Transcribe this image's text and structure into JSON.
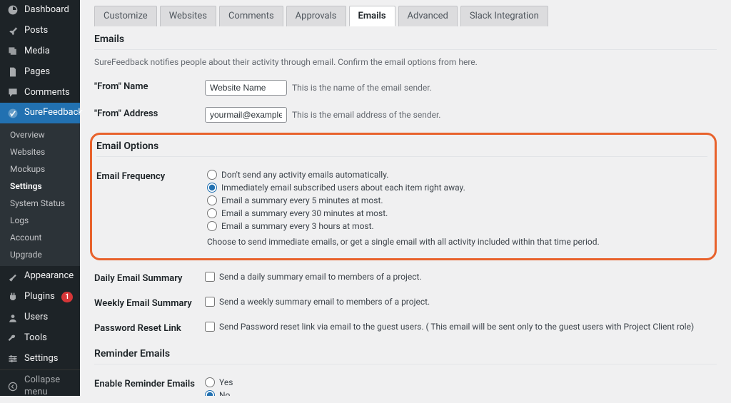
{
  "sidebar": {
    "dashboard": "Dashboard",
    "posts": "Posts",
    "media": "Media",
    "pages": "Pages",
    "comments": "Comments",
    "surefeedback": "SureFeedback",
    "sf_sub": [
      "Overview",
      "Websites",
      "Mockups",
      "Settings",
      "System Status",
      "Logs",
      "Account",
      "Upgrade"
    ],
    "appearance": "Appearance",
    "plugins": "Plugins",
    "plugins_badge": "1",
    "users": "Users",
    "tools": "Tools",
    "settings": "Settings",
    "collapse": "Collapse menu"
  },
  "tabs": [
    "Customize",
    "Websites",
    "Comments",
    "Approvals",
    "Emails",
    "Advanced",
    "Slack Integration"
  ],
  "emails": {
    "heading": "Emails",
    "desc": "SureFeedback notifies people about their activity through email. Confirm the email options from here.",
    "from_name_label": "\"From\" Name",
    "from_name_value": "Website Name",
    "from_name_hint": "This is the name of the email sender.",
    "from_addr_label": "\"From\" Address",
    "from_addr_value": "yourmail@example.com",
    "from_addr_hint": "This is the email address of the sender."
  },
  "options": {
    "heading": "Email Options",
    "freq_label": "Email Frequency",
    "freq_opts": [
      "Don't send any activity emails automatically.",
      "Immediately email subscribed users about each item right away.",
      "Email a summary every 5 minutes at most.",
      "Email a summary every 30 minutes at most.",
      "Email a summary every 3 hours at most."
    ],
    "freq_note": "Choose to send immediate emails, or get a single email with all activity included within that time period.",
    "daily_label": "Daily Email Summary",
    "daily_text": "Send a daily summary email to members of a project.",
    "weekly_label": "Weekly Email Summary",
    "weekly_text": "Send a weekly summary email to members of a project.",
    "pwd_label": "Password Reset Link",
    "pwd_text": "Send Password reset link via email to the guest users. ( This email will be sent only to the guest users with Project Client role)"
  },
  "reminder": {
    "heading": "Reminder Emails",
    "enable_label": "Enable Reminder Emails",
    "yes": "Yes",
    "no": "No"
  }
}
